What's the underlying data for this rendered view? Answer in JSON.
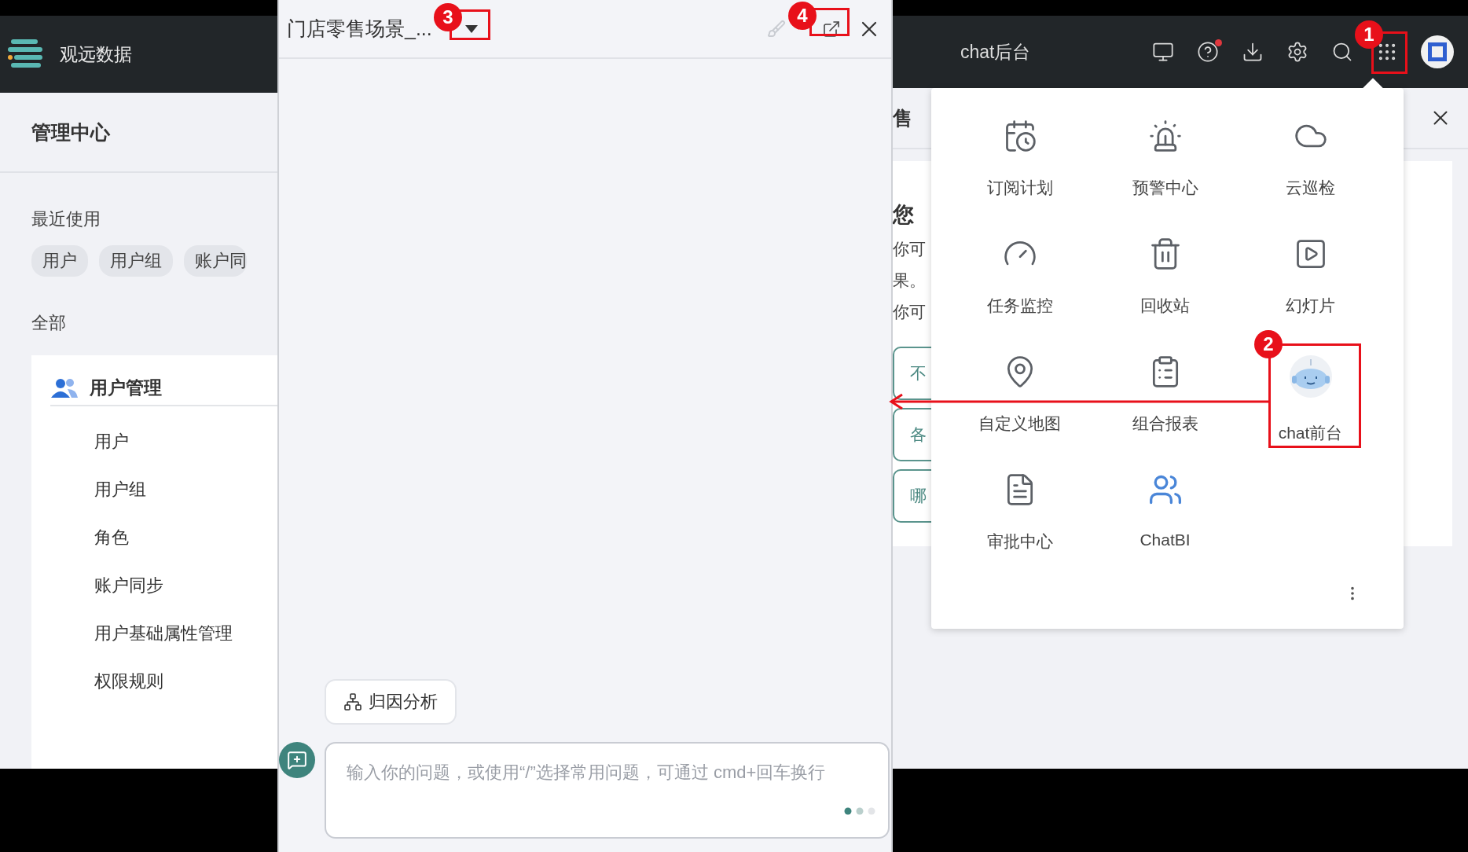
{
  "left_app": {
    "brand": "观远数据",
    "section_title": "管理中心",
    "recent_label": "最近使用",
    "recent_chips": [
      "用户",
      "用户组",
      "账户同"
    ],
    "all_label": "全部",
    "group": {
      "title": "用户管理",
      "items": [
        "用户",
        "用户组",
        "角色",
        "账户同步",
        "用户基础属性管理",
        "权限规则"
      ]
    }
  },
  "chat_panel": {
    "title": "门店零售场景_...",
    "quick_action": "归因分析",
    "input": {
      "placeholder": "输入你的问题，或使用“/”选择常用问题，可通过 cmd+回车换行"
    }
  },
  "right_app": {
    "nav_item": "chat后台",
    "help_has_notification": true,
    "page_title": "售",
    "greeting": "您",
    "lines": [
      "你可",
      "果。",
      "你可"
    ],
    "suggestions": [
      "不",
      "各",
      "哪"
    ],
    "menu": [
      {
        "label": "订阅计划"
      },
      {
        "label": "预警中心"
      },
      {
        "label": "云巡检"
      },
      {
        "label": "任务监控"
      },
      {
        "label": "回收站"
      },
      {
        "label": "幻灯片"
      },
      {
        "label": "自定义地图"
      },
      {
        "label": "组合报表"
      },
      {
        "label": "chat前台"
      },
      {
        "label": "审批中心"
      },
      {
        "label": "ChatBI"
      }
    ]
  },
  "annotations": [
    {
      "label": "1"
    },
    {
      "label": "2"
    },
    {
      "label": "3"
    },
    {
      "label": "4"
    }
  ]
}
